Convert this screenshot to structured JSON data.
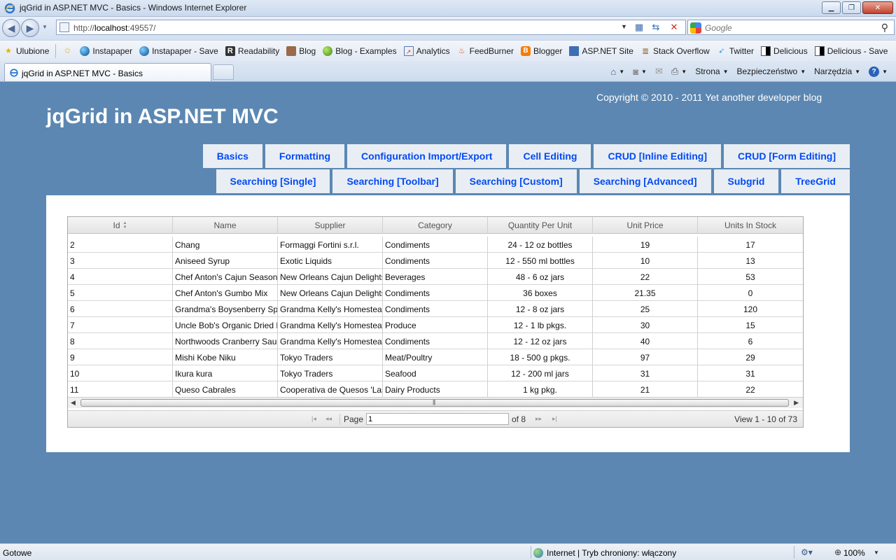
{
  "browser": {
    "window_title": "jqGrid in ASP.NET MVC - Basics - Windows Internet Explorer",
    "address": {
      "prefix": "http://",
      "host": "localhost",
      "port": ":49557/"
    },
    "search_placeholder": "Google",
    "favorites": [
      {
        "label": "Ulubione",
        "icon": "star-icon"
      },
      {
        "label": "Instapaper",
        "icon": "globe-icon"
      },
      {
        "label": "Instapaper - Save",
        "icon": "globe-icon"
      },
      {
        "label": "Readability",
        "icon": "readability-icon"
      },
      {
        "label": "Blog",
        "icon": "avatar-icon"
      },
      {
        "label": "Blog - Examples",
        "icon": "green-dot-icon"
      },
      {
        "label": "Analytics",
        "icon": "chart-icon"
      },
      {
        "label": "FeedBurner",
        "icon": "flame-icon"
      },
      {
        "label": "Blogger",
        "icon": "blogger-icon"
      },
      {
        "label": "ASP.NET Site",
        "icon": "aspnet-icon"
      },
      {
        "label": "Stack Overflow",
        "icon": "stack-icon"
      },
      {
        "label": "Twitter",
        "icon": "bird-icon"
      },
      {
        "label": "Delicious",
        "icon": "delicious-icon"
      },
      {
        "label": "Delicious - Save",
        "icon": "delicious-icon"
      }
    ],
    "tab_label": "jqGrid in ASP.NET MVC - Basics",
    "commands": {
      "page": "Strona",
      "safety": "Bezpieczeństwo",
      "tools": "Narzędzia"
    },
    "status": {
      "left": "Gotowe",
      "zone": "Internet | Tryb chroniony: włączony",
      "zoom": "100%"
    }
  },
  "site": {
    "title": "jqGrid in ASP.NET MVC",
    "copyright": "Copyright © 2010 - 2011 Yet another developer blog",
    "menu_row1": [
      "Basics",
      "Formatting",
      "Configuration Import/Export",
      "Cell Editing",
      "CRUD [Inline Editing]",
      "CRUD [Form Editing]"
    ],
    "menu_row2": [
      "Searching [Single]",
      "Searching [Toolbar]",
      "Searching [Custom]",
      "Searching [Advanced]",
      "Subgrid",
      "TreeGrid"
    ]
  },
  "grid": {
    "columns": [
      "Id",
      "Name",
      "Supplier",
      "Category",
      "Quantity Per Unit",
      "Unit Price",
      "Units In Stock"
    ],
    "rows": [
      [
        "2",
        "Chang",
        "Formaggi Fortini s.r.l.",
        "Condiments",
        "24 - 12 oz bottles",
        "19",
        "17"
      ],
      [
        "3",
        "Aniseed Syrup",
        "Exotic Liquids",
        "Condiments",
        "12 - 550 ml bottles",
        "10",
        "13"
      ],
      [
        "4",
        "Chef Anton's Cajun Seasoning",
        "New Orleans Cajun Delights",
        "Beverages",
        "48 - 6 oz jars",
        "22",
        "53"
      ],
      [
        "5",
        "Chef Anton's Gumbo Mix",
        "New Orleans Cajun Delights",
        "Condiments",
        "36 boxes",
        "21.35",
        "0"
      ],
      [
        "6",
        "Grandma's Boysenberry Spread",
        "Grandma Kelly's Homestead",
        "Condiments",
        "12 - 8 oz jars",
        "25",
        "120"
      ],
      [
        "7",
        "Uncle Bob's Organic Dried Pears",
        "Grandma Kelly's Homestead",
        "Produce",
        "12 - 1 lb pkgs.",
        "30",
        "15"
      ],
      [
        "8",
        "Northwoods Cranberry Sauce",
        "Grandma Kelly's Homestead",
        "Condiments",
        "12 - 12 oz jars",
        "40",
        "6"
      ],
      [
        "9",
        "Mishi Kobe Niku",
        "Tokyo Traders",
        "Meat/Poultry",
        "18 - 500 g pkgs.",
        "97",
        "29"
      ],
      [
        "10",
        "Ikura kura",
        "Tokyo Traders",
        "Seafood",
        "12 - 200 ml jars",
        "31",
        "31"
      ],
      [
        "11",
        "Queso Cabrales",
        "Cooperativa de Quesos 'Las Cabras'",
        "Dairy Products",
        "1 kg pkg.",
        "21",
        "22"
      ]
    ],
    "pager": {
      "page_label": "Page",
      "page_value": "1",
      "of_label": "of 8",
      "view_text": "View 1 - 10 of 73"
    }
  }
}
